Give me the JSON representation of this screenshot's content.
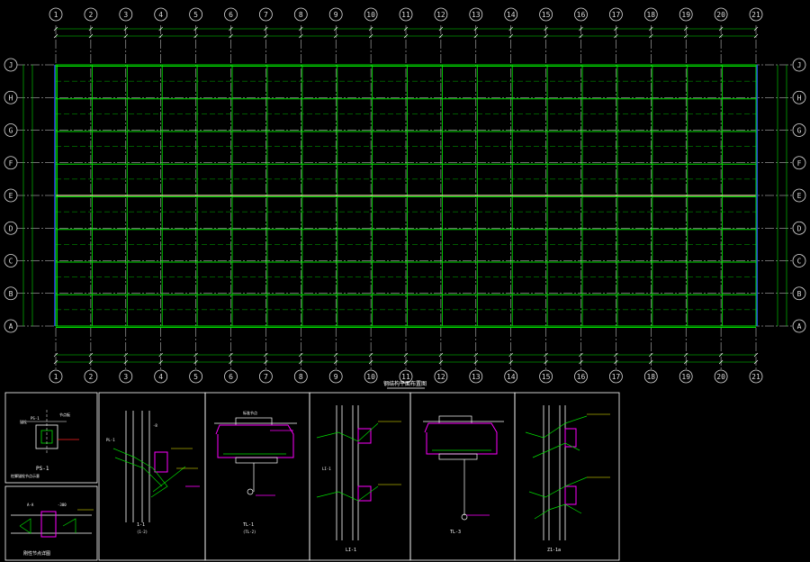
{
  "columns": [
    "1",
    "2",
    "3",
    "4",
    "5",
    "6",
    "7",
    "8",
    "9",
    "10",
    "11",
    "12",
    "13",
    "14",
    "15",
    "16",
    "17",
    "18",
    "19",
    "20",
    "21"
  ],
  "rows": [
    "J",
    "H",
    "G",
    "F",
    "E",
    "D",
    "C",
    "B",
    "A"
  ],
  "plan_title": "钢结构平面布置图",
  "colors": {
    "background": "#000000",
    "grid_axis": "#dddddd",
    "beam": "#00e000",
    "steel_highlight": "#ff00ff",
    "edge_column": "#3030ff",
    "dimension_text": "#ffffff",
    "note_text": "#ffff00",
    "accent_red": "#ff2020"
  },
  "details": [
    {
      "title": "PS-1",
      "note": "柱脚锚栓节点示意"
    },
    {
      "title": "刚性节点详图",
      "note": ""
    },
    {
      "title": "1-1",
      "note": "(1-2)"
    },
    {
      "title": "TL-1",
      "note": "(TL-2)"
    },
    {
      "title": "LI-1",
      "note": ""
    },
    {
      "title": "TL-3",
      "note": ""
    },
    {
      "title": "Z1-1a",
      "note": ""
    }
  ]
}
